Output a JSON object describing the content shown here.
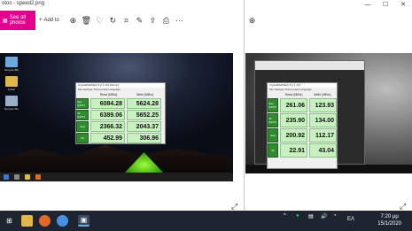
{
  "left_window": {
    "title": "otos - speed2.png",
    "see_all_label": "See all photos",
    "add_to_label": "Add to",
    "toolbar_icons": [
      "zoom-in-icon",
      "delete-icon",
      "favorite-icon",
      "rotate-icon",
      "crop-icon",
      "edit-icon",
      "share-icon",
      "print-icon",
      "more-icon"
    ],
    "desktop_icons": [
      "Recycle Bin",
      "Folder",
      "Recycle Bin"
    ],
    "cdm_title": "CrystalDiskMark 5.2.1 x64 [Admin]",
    "cdm_menu": "File Settings Theme Help Language",
    "cdm_head_read": "Read [MB/s]",
    "cdm_head_write": "Write [MB/s]",
    "rows": [
      {
        "label": "Seq Q32T1",
        "read": "6084.28",
        "write": "5624.28"
      },
      {
        "label": "4K Q32T1",
        "read": "6389.06",
        "write": "5652.25"
      },
      {
        "label": "Seq",
        "read": "2366.32",
        "write": "2043.37"
      },
      {
        "label": "4K",
        "read": "452.99",
        "write": "306.96"
      }
    ]
  },
  "right_window": {
    "cdm_title": "CrystalDiskMark 5.2.1 x64",
    "cdm_menu": "File Settings Theme Help Language",
    "cdm_head_read": "Read (MB/s)",
    "cdm_head_write": "Write (MB/s)",
    "rows": [
      {
        "label": "Seq Q32T1",
        "read": "261.06",
        "write": "123.93"
      },
      {
        "label": "4K Q32T1",
        "read": "235.90",
        "write": "134.00"
      },
      {
        "label": "Seq",
        "read": "200.92",
        "write": "112.17"
      },
      {
        "label": "4K",
        "read": "22.91",
        "write": "43.04"
      }
    ]
  },
  "taskbar": {
    "tray_lang": "ΕΛ",
    "time": "7:20 μμ",
    "date": "15/1/2020"
  },
  "colors": {
    "photos_accent": "#e3008c",
    "cdm_green": "#2e8b2e",
    "cdm_cell": "#c9f0c0",
    "taskbar": "#1f2530"
  }
}
